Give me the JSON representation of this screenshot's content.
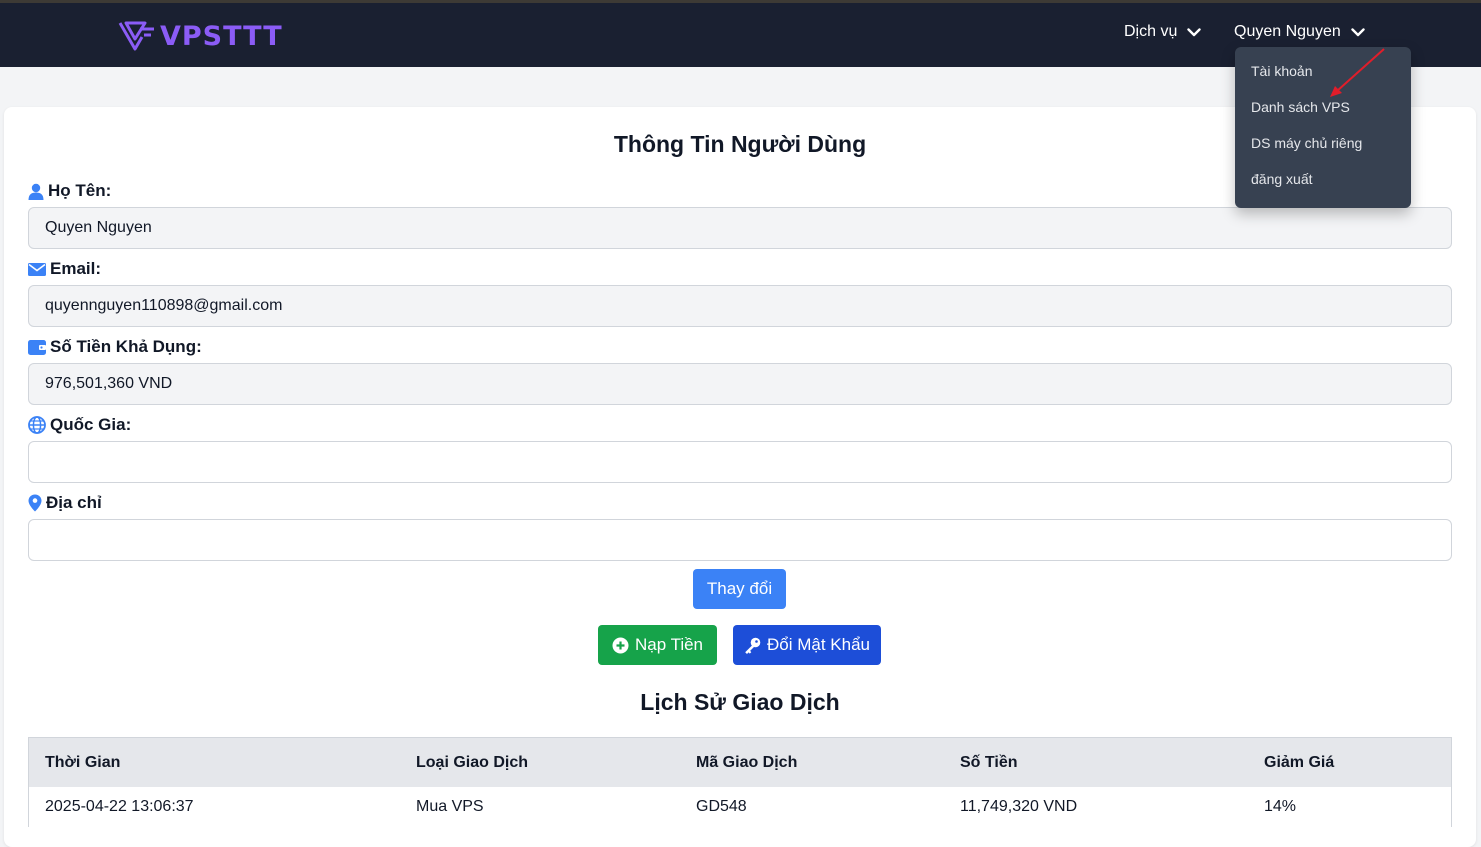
{
  "brand": {
    "name": "VPSTTT",
    "color": "#8b5cf6"
  },
  "navbar": {
    "services_label": "Dịch vụ",
    "user_label": "Quyen Nguyen"
  },
  "user_menu": {
    "items": [
      {
        "label": "Tài khoản"
      },
      {
        "label": "Danh sách VPS"
      },
      {
        "label": "DS máy chủ riêng"
      },
      {
        "label": "đăng xuất"
      }
    ]
  },
  "profile": {
    "title": "Thông Tin Người Dùng",
    "fields": {
      "name": {
        "label": "Họ Tên:",
        "value": "Quyen Nguyen",
        "icon": "user-icon"
      },
      "email": {
        "label": "Email:",
        "value": "quyennguyen110898@gmail.com",
        "icon": "envelope-icon"
      },
      "balance": {
        "label": "Số Tiền Khả Dụng:",
        "value": "976,501,360 VND",
        "icon": "wallet-icon"
      },
      "country": {
        "label": "Quốc Gia:",
        "value": "",
        "icon": "globe-icon"
      },
      "address": {
        "label": "Địa chỉ",
        "value": "",
        "icon": "map-pin-icon"
      }
    },
    "change_button": "Thay đổi",
    "topup_button": "Nạp Tiền",
    "password_button": "Đổi Mật Khẩu"
  },
  "history": {
    "title": "Lịch Sử Giao Dịch",
    "columns": [
      "Thời Gian",
      "Loại Giao Dịch",
      "Mã Giao Dịch",
      "Số Tiền",
      "Giảm Giá"
    ],
    "rows": [
      [
        "2025-04-22 13:06:37",
        "Mua VPS",
        "GD548",
        "11,749,320 VND",
        "14%"
      ]
    ]
  },
  "colors": {
    "navbar_bg": "#1a2031",
    "dropdown_bg": "#374151",
    "primary": "#3b82f6",
    "success": "#16a34a",
    "accent_blue": "#1d4ed8",
    "annotation_arrow": "#e11d2a"
  }
}
